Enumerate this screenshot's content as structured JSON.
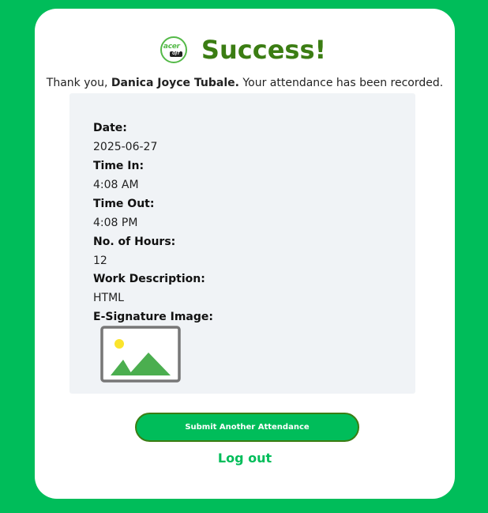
{
  "header": {
    "logo_text": "acer",
    "logo_badge": "OJT",
    "title": "Success!"
  },
  "message": {
    "prefix": "Thank you, ",
    "name": "Danica Joyce Tubale.",
    "suffix": " Your attendance has been recorded."
  },
  "details": {
    "date_label": "Date:",
    "date_value": "2025-06-27",
    "time_in_label": "Time In:",
    "time_in_value": "4:08 AM",
    "time_out_label": "Time Out:",
    "time_out_value": "4:08 PM",
    "hours_label": "No. of Hours:",
    "hours_value": "12",
    "work_label": "Work Description:",
    "work_value": "HTML",
    "signature_label": "E-Signature Image:",
    "signature_icon": "broken-image-placeholder-icon"
  },
  "actions": {
    "submit_label": "Submit Another Attendance",
    "logout_label": "Log out"
  },
  "colors": {
    "background": "#00bd5a",
    "title": "#3b7d13",
    "panel": "#f0f3f6",
    "accent": "#00bd5a"
  }
}
